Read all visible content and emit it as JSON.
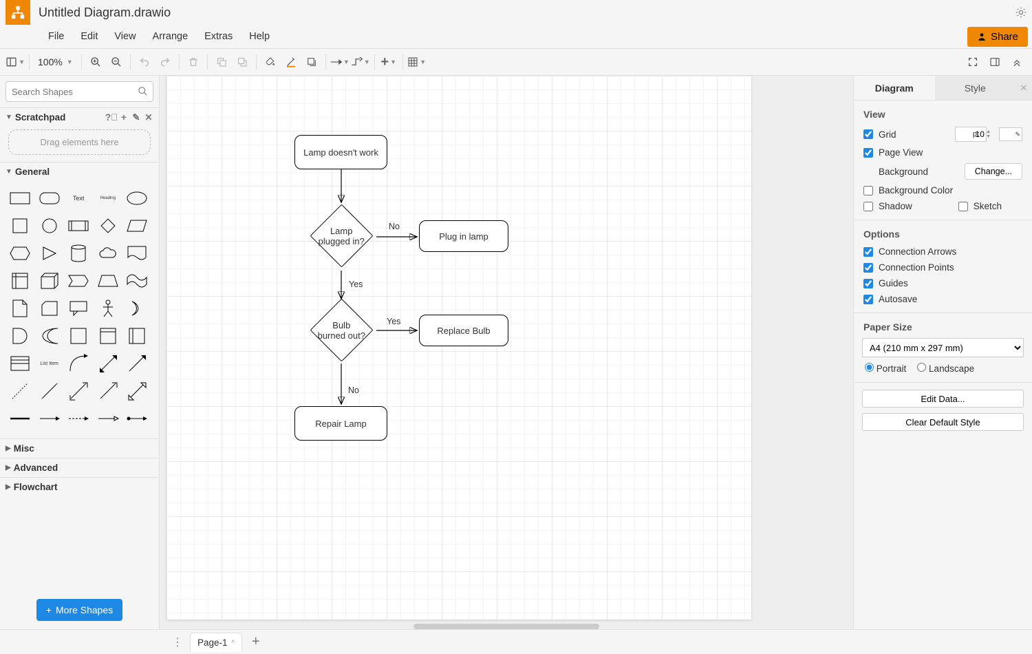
{
  "title": "Untitled Diagram.drawio",
  "menubar": [
    "File",
    "Edit",
    "View",
    "Arrange",
    "Extras",
    "Help"
  ],
  "share_label": "Share",
  "toolbar": {
    "zoom": "100%"
  },
  "left": {
    "search_placeholder": "Search Shapes",
    "scratchpad": {
      "title": "Scratchpad",
      "drop_hint": "Drag elements here"
    },
    "sections": {
      "general": "General",
      "misc": "Misc",
      "advanced": "Advanced",
      "flowchart": "Flowchart"
    },
    "more_shapes": "More Shapes",
    "general_shape_labels": {
      "text": "Text",
      "heading": "Heading",
      "list_item": "List Item"
    }
  },
  "canvas": {
    "nodes": {
      "n1": "Lamp doesn't work",
      "n2": "Lamp\nplugged in?",
      "n3": "Plug in lamp",
      "n4": "Bulb\nburned out?",
      "n5": "Replace Bulb",
      "n6": "Repair Lamp"
    },
    "edge_labels": {
      "e2no": "No",
      "e2yes": "Yes",
      "e4yes": "Yes",
      "e4no": "No"
    }
  },
  "right": {
    "tabs": {
      "diagram": "Diagram",
      "style": "Style"
    },
    "view": {
      "title": "View",
      "grid": {
        "label": "Grid",
        "checked": true,
        "value": "10",
        "unit": "pt"
      },
      "page_view": {
        "label": "Page View",
        "checked": true
      },
      "background": {
        "label": "Background",
        "change": "Change..."
      },
      "background_color": {
        "label": "Background Color",
        "checked": false
      },
      "shadow": {
        "label": "Shadow",
        "checked": false
      },
      "sketch": {
        "label": "Sketch",
        "checked": false
      }
    },
    "options": {
      "title": "Options",
      "connection_arrows": {
        "label": "Connection Arrows",
        "checked": true
      },
      "connection_points": {
        "label": "Connection Points",
        "checked": true
      },
      "guides": {
        "label": "Guides",
        "checked": true
      },
      "autosave": {
        "label": "Autosave",
        "checked": true
      }
    },
    "paper": {
      "title": "Paper Size",
      "value": "A4 (210 mm x 297 mm)",
      "portrait": "Portrait",
      "landscape": "Landscape"
    },
    "edit_data": "Edit Data...",
    "clear_style": "Clear Default Style"
  },
  "bottom": {
    "page": "Page-1"
  }
}
